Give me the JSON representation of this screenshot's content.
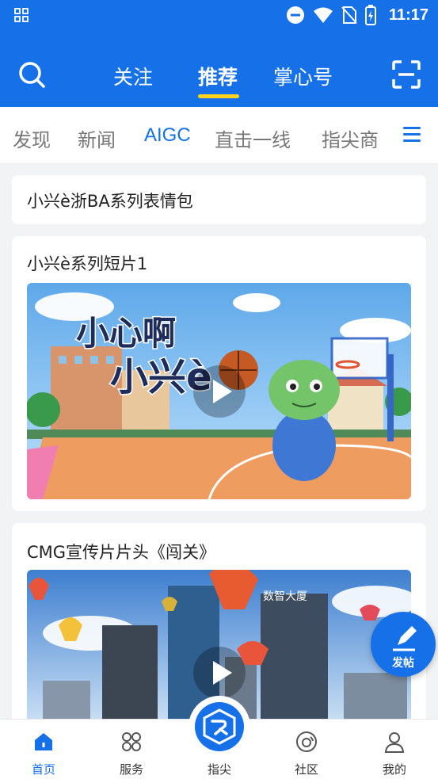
{
  "status_bar": {
    "time": "11:17"
  },
  "top_tabs": [
    {
      "label": "关注"
    },
    {
      "label": "推荐"
    },
    {
      "label": "掌心号"
    }
  ],
  "categories": [
    {
      "label": "发现"
    },
    {
      "label": "新闻"
    },
    {
      "label": "AIGC"
    },
    {
      "label": "直击一线"
    },
    {
      "label": "指尖商"
    }
  ],
  "feed": [
    {
      "title": "小兴è浙BA系列表情包"
    },
    {
      "title": "小兴è系列短片1",
      "video_overlay_text_1": "小心啊",
      "video_overlay_text_2": "小兴è"
    },
    {
      "title": "CMG宣传片片头《闯关》",
      "building_sign": "数智大厦"
    }
  ],
  "fab": {
    "label": "发帖"
  },
  "bottom_nav": [
    {
      "label": "首页"
    },
    {
      "label": "服务"
    },
    {
      "label": "指尖"
    },
    {
      "label": "社区"
    },
    {
      "label": "我的"
    }
  ],
  "colors": {
    "brand_blue": "#1670e8",
    "tab_indicator": "#ffd21e"
  }
}
